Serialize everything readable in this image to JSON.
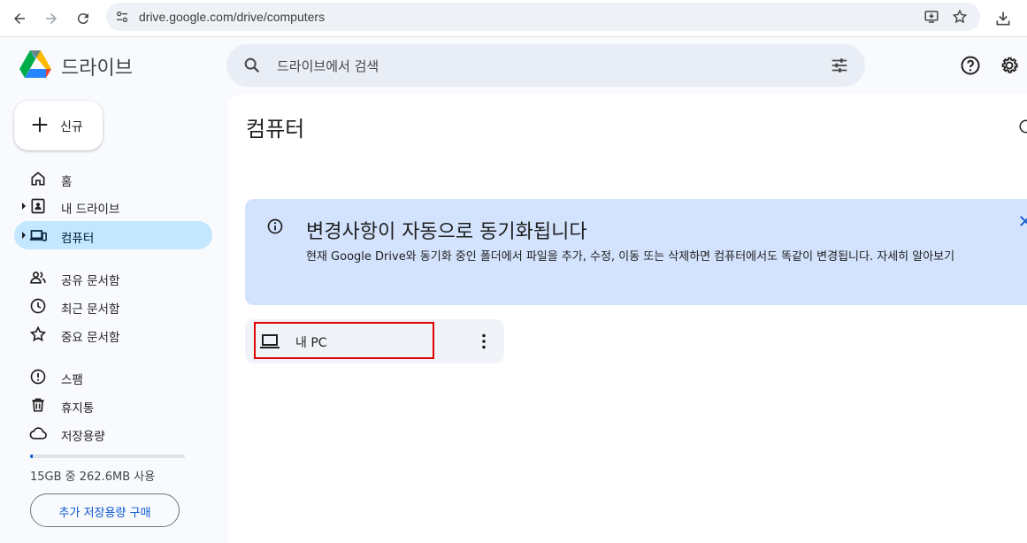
{
  "browser": {
    "url": "drive.google.com/drive/computers",
    "icons": [
      "back-arrow-icon",
      "forward-arrow-icon",
      "reload-icon",
      "site-settings-icon",
      "install-app-icon",
      "bookmark-star-icon",
      "download-icon"
    ]
  },
  "header": {
    "app_title": "드라이브",
    "search_placeholder": "드라이브에서 검색",
    "icons": [
      "drive-logo",
      "search-icon",
      "search-options-icon",
      "help-icon",
      "settings-gear-icon"
    ]
  },
  "sidebar": {
    "new_label": "신규",
    "items": [
      {
        "label": "홈",
        "icon": "home-icon"
      },
      {
        "label": "내 드라이브",
        "icon": "my-drive-icon"
      },
      {
        "label": "컴퓨터",
        "icon": "computers-icon",
        "active": true
      },
      {
        "label": "공유 문서함",
        "icon": "shared-people-icon"
      },
      {
        "label": "최근 문서함",
        "icon": "clock-icon"
      },
      {
        "label": "중요 문서함",
        "icon": "star-icon"
      },
      {
        "label": "스팸",
        "icon": "spam-icon"
      },
      {
        "label": "휴지통",
        "icon": "trash-icon"
      },
      {
        "label": "저장용량",
        "icon": "cloud-icon"
      }
    ],
    "storage_used_fraction": 0.017,
    "storage_text": "15GB 중 262.6MB 사용",
    "buy_storage_label": "추가 저장용량 구매"
  },
  "main": {
    "title": "컴퓨터",
    "banner": {
      "title": "변경사항이 자동으로 동기화됩니다",
      "body": "현재 Google Drive와 동기화 중인 폴더에서 파일을 추가, 수정, 이동 또는 삭제하면 컴퓨터에서도 똑같이 변경됩니다. 자세히 알아보기"
    },
    "computers": [
      {
        "name": "내 PC",
        "icon": "laptop-icon"
      }
    ]
  },
  "colors": {
    "accent": "#0b57d0",
    "active_nav": "#c2e7ff",
    "banner": "#d3e3fd",
    "highlight_box": "#e00000"
  }
}
